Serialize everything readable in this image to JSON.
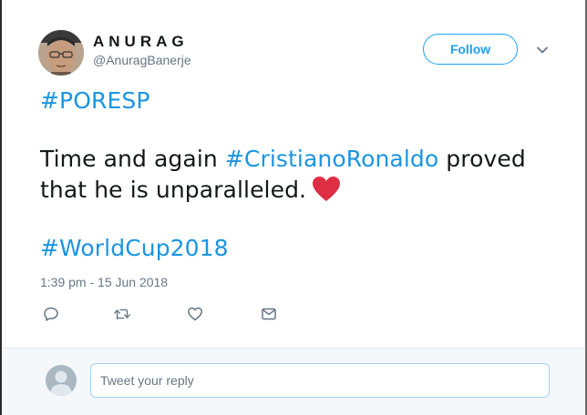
{
  "tweet": {
    "author": {
      "display_name": "ANURAG",
      "handle": "@AnuragBanerje"
    },
    "follow_label": "Follow",
    "text": {
      "line1_hashtag": "#PORESP",
      "line2_pre": "Time and again ",
      "line2_hashtag": "#CristianoRonaldo",
      "line2_post": " proved",
      "line3": "that he is unparalleled.",
      "line4_hashtag": "#WorldCup2018"
    },
    "emoji": "red-heart",
    "timestamp": "1:39 pm - 15 Jun 2018",
    "actions": [
      "reply-icon",
      "retweet-icon",
      "like-icon",
      "direct-message-icon"
    ]
  },
  "reply": {
    "placeholder": "Tweet your reply"
  },
  "colors": {
    "accent": "#1da1f2",
    "hashtag": "#1b95e0",
    "text": "#14171a",
    "muted": "#657786",
    "heart": "#dd2e44"
  }
}
